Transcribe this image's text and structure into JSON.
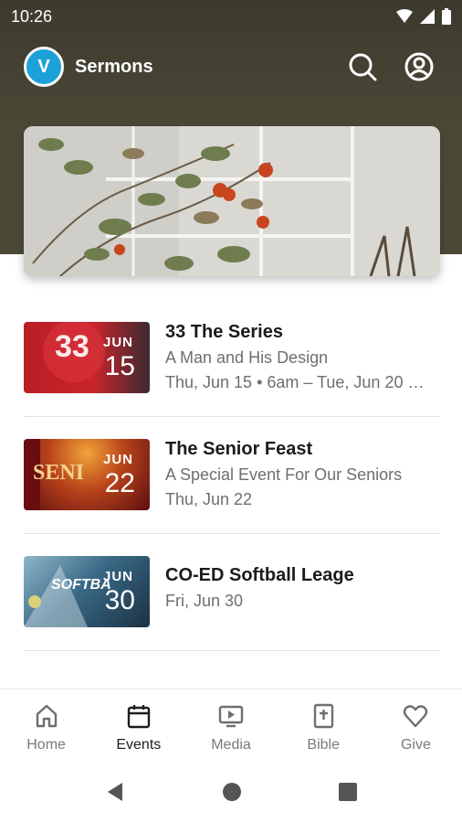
{
  "status_bar": {
    "time": "10:26"
  },
  "header": {
    "title": "Sermons",
    "logo_letter": "V"
  },
  "events": [
    {
      "title": "33 The Series",
      "subtitle": "A Man and His Design",
      "date": "Thu, Jun 15 • 6am – Tue, Jun 20 …",
      "month": "JUN",
      "day": "15"
    },
    {
      "title": "The Senior Feast",
      "subtitle": "A Special Event For Our Seniors",
      "date": "Thu, Jun 22",
      "month": "JUN",
      "day": "22"
    },
    {
      "title": "CO-ED Softball Leage",
      "date": "Fri, Jun 30",
      "month": "JUN",
      "day": "30"
    }
  ],
  "nav": [
    {
      "label": "Home"
    },
    {
      "label": "Events"
    },
    {
      "label": "Media"
    },
    {
      "label": "Bible"
    },
    {
      "label": "Give"
    }
  ]
}
